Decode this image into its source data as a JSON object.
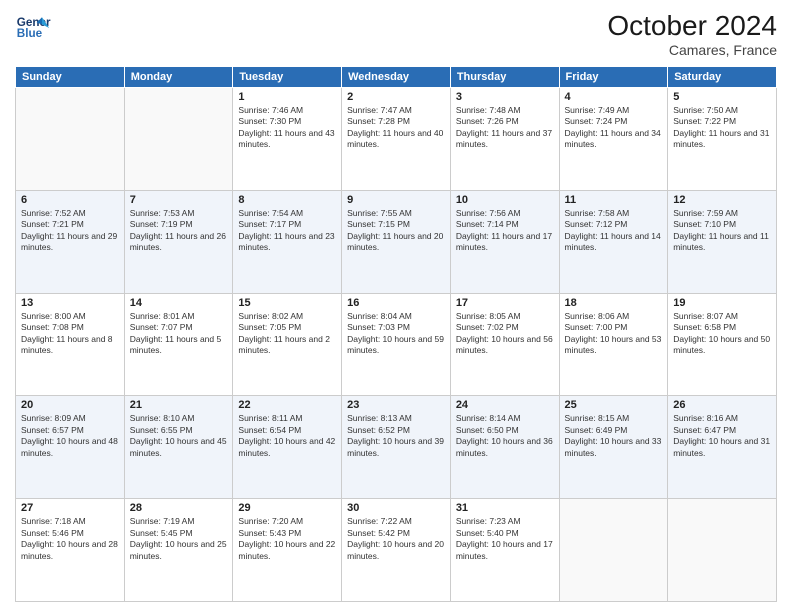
{
  "header": {
    "logo_line1": "General",
    "logo_line2": "Blue",
    "month": "October 2024",
    "location": "Camares, France"
  },
  "weekdays": [
    "Sunday",
    "Monday",
    "Tuesday",
    "Wednesday",
    "Thursday",
    "Friday",
    "Saturday"
  ],
  "weeks": [
    [
      {
        "day": "",
        "info": ""
      },
      {
        "day": "",
        "info": ""
      },
      {
        "day": "1",
        "info": "Sunrise: 7:46 AM\nSunset: 7:30 PM\nDaylight: 11 hours and 43 minutes."
      },
      {
        "day": "2",
        "info": "Sunrise: 7:47 AM\nSunset: 7:28 PM\nDaylight: 11 hours and 40 minutes."
      },
      {
        "day": "3",
        "info": "Sunrise: 7:48 AM\nSunset: 7:26 PM\nDaylight: 11 hours and 37 minutes."
      },
      {
        "day": "4",
        "info": "Sunrise: 7:49 AM\nSunset: 7:24 PM\nDaylight: 11 hours and 34 minutes."
      },
      {
        "day": "5",
        "info": "Sunrise: 7:50 AM\nSunset: 7:22 PM\nDaylight: 11 hours and 31 minutes."
      }
    ],
    [
      {
        "day": "6",
        "info": "Sunrise: 7:52 AM\nSunset: 7:21 PM\nDaylight: 11 hours and 29 minutes."
      },
      {
        "day": "7",
        "info": "Sunrise: 7:53 AM\nSunset: 7:19 PM\nDaylight: 11 hours and 26 minutes."
      },
      {
        "day": "8",
        "info": "Sunrise: 7:54 AM\nSunset: 7:17 PM\nDaylight: 11 hours and 23 minutes."
      },
      {
        "day": "9",
        "info": "Sunrise: 7:55 AM\nSunset: 7:15 PM\nDaylight: 11 hours and 20 minutes."
      },
      {
        "day": "10",
        "info": "Sunrise: 7:56 AM\nSunset: 7:14 PM\nDaylight: 11 hours and 17 minutes."
      },
      {
        "day": "11",
        "info": "Sunrise: 7:58 AM\nSunset: 7:12 PM\nDaylight: 11 hours and 14 minutes."
      },
      {
        "day": "12",
        "info": "Sunrise: 7:59 AM\nSunset: 7:10 PM\nDaylight: 11 hours and 11 minutes."
      }
    ],
    [
      {
        "day": "13",
        "info": "Sunrise: 8:00 AM\nSunset: 7:08 PM\nDaylight: 11 hours and 8 minutes."
      },
      {
        "day": "14",
        "info": "Sunrise: 8:01 AM\nSunset: 7:07 PM\nDaylight: 11 hours and 5 minutes."
      },
      {
        "day": "15",
        "info": "Sunrise: 8:02 AM\nSunset: 7:05 PM\nDaylight: 11 hours and 2 minutes."
      },
      {
        "day": "16",
        "info": "Sunrise: 8:04 AM\nSunset: 7:03 PM\nDaylight: 10 hours and 59 minutes."
      },
      {
        "day": "17",
        "info": "Sunrise: 8:05 AM\nSunset: 7:02 PM\nDaylight: 10 hours and 56 minutes."
      },
      {
        "day": "18",
        "info": "Sunrise: 8:06 AM\nSunset: 7:00 PM\nDaylight: 10 hours and 53 minutes."
      },
      {
        "day": "19",
        "info": "Sunrise: 8:07 AM\nSunset: 6:58 PM\nDaylight: 10 hours and 50 minutes."
      }
    ],
    [
      {
        "day": "20",
        "info": "Sunrise: 8:09 AM\nSunset: 6:57 PM\nDaylight: 10 hours and 48 minutes."
      },
      {
        "day": "21",
        "info": "Sunrise: 8:10 AM\nSunset: 6:55 PM\nDaylight: 10 hours and 45 minutes."
      },
      {
        "day": "22",
        "info": "Sunrise: 8:11 AM\nSunset: 6:54 PM\nDaylight: 10 hours and 42 minutes."
      },
      {
        "day": "23",
        "info": "Sunrise: 8:13 AM\nSunset: 6:52 PM\nDaylight: 10 hours and 39 minutes."
      },
      {
        "day": "24",
        "info": "Sunrise: 8:14 AM\nSunset: 6:50 PM\nDaylight: 10 hours and 36 minutes."
      },
      {
        "day": "25",
        "info": "Sunrise: 8:15 AM\nSunset: 6:49 PM\nDaylight: 10 hours and 33 minutes."
      },
      {
        "day": "26",
        "info": "Sunrise: 8:16 AM\nSunset: 6:47 PM\nDaylight: 10 hours and 31 minutes."
      }
    ],
    [
      {
        "day": "27",
        "info": "Sunrise: 7:18 AM\nSunset: 5:46 PM\nDaylight: 10 hours and 28 minutes."
      },
      {
        "day": "28",
        "info": "Sunrise: 7:19 AM\nSunset: 5:45 PM\nDaylight: 10 hours and 25 minutes."
      },
      {
        "day": "29",
        "info": "Sunrise: 7:20 AM\nSunset: 5:43 PM\nDaylight: 10 hours and 22 minutes."
      },
      {
        "day": "30",
        "info": "Sunrise: 7:22 AM\nSunset: 5:42 PM\nDaylight: 10 hours and 20 minutes."
      },
      {
        "day": "31",
        "info": "Sunrise: 7:23 AM\nSunset: 5:40 PM\nDaylight: 10 hours and 17 minutes."
      },
      {
        "day": "",
        "info": ""
      },
      {
        "day": "",
        "info": ""
      }
    ]
  ]
}
